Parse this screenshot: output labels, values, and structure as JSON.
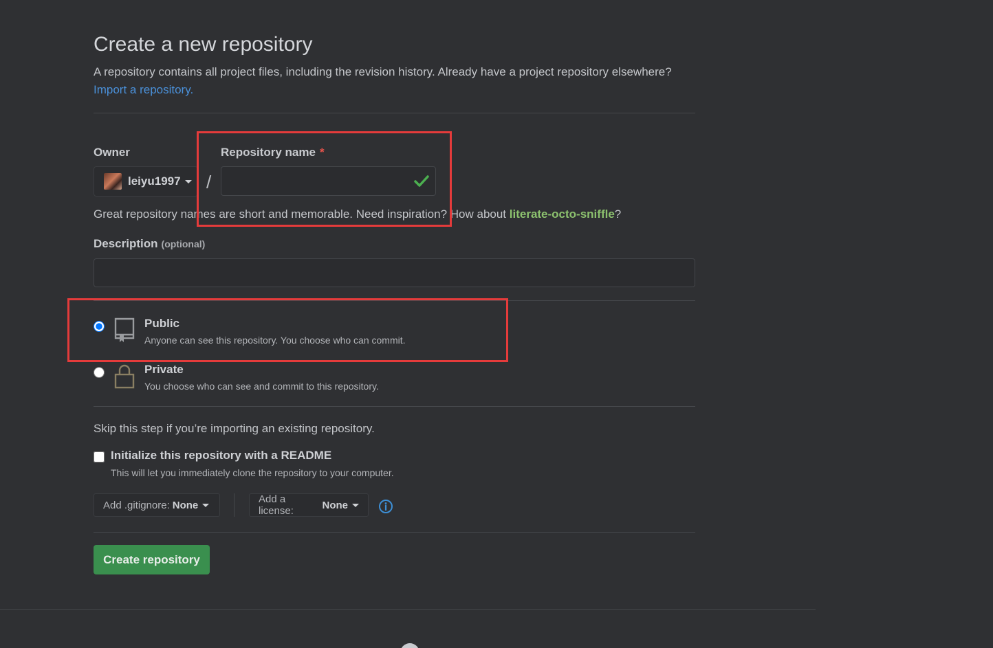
{
  "header": {
    "title": "Create a new repository",
    "subtitle": "A repository contains all project files, including the revision history. Already have a project repository elsewhere?",
    "import_link": "Import a repository."
  },
  "owner": {
    "label": "Owner",
    "value": "leiyu1997"
  },
  "repo_name": {
    "label": "Repository name",
    "required_marker": "*",
    "value": "",
    "separator": "/"
  },
  "hint": {
    "text": "Great repository names are short and memorable. Need inspiration? How about ",
    "suggestion": "literate-octo-sniffle",
    "suffix": "?"
  },
  "description": {
    "label": "Description",
    "optional": "(optional)",
    "value": ""
  },
  "visibility": {
    "selected": "public",
    "public": {
      "title": "Public",
      "desc": "Anyone can see this repository. You choose who can commit."
    },
    "private": {
      "title": "Private",
      "desc": "You choose who can see and commit to this repository."
    }
  },
  "init": {
    "skip_text": "Skip this step if you’re importing an existing repository.",
    "readme_label": "Initialize this repository with a README",
    "readme_desc": "This will let you immediately clone the repository to your computer.",
    "readme_checked": false
  },
  "gitignore": {
    "label": "Add .gitignore:",
    "value": "None"
  },
  "license": {
    "label": "Add a license:",
    "value": "None"
  },
  "actions": {
    "create_label": "Create repository"
  },
  "colors": {
    "background": "#2f3033",
    "link": "#4a90d9",
    "suggestion": "#8cc16e",
    "primary_button": "#3a8f4e",
    "highlight": "#e53b3b",
    "required": "#e5534b"
  },
  "icons": {
    "valid": "check-icon",
    "public": "repo-book-icon",
    "private": "lock-icon",
    "info": "info-icon"
  }
}
